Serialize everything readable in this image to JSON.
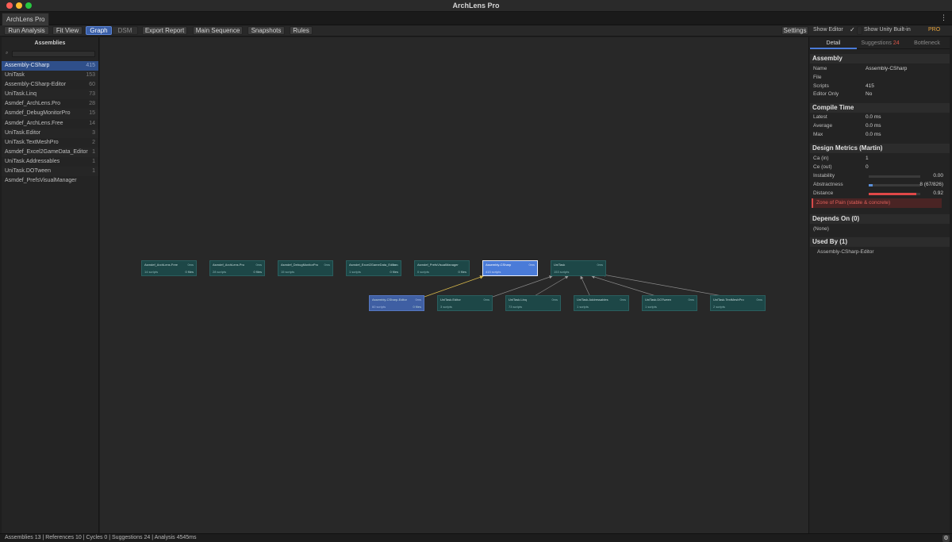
{
  "window": {
    "title": "ArchLens Pro"
  },
  "tab": {
    "label": "ArchLens Pro",
    "menu_icon": "⋮"
  },
  "toolbar": {
    "run_analysis": "Run Analysis",
    "fit_view": "Fit View",
    "graph": "Graph",
    "dsm": "DSM",
    "export_report": "Export Report",
    "main_sequence": "Main Sequence",
    "snapshots": "Snapshots",
    "rules": "Rules",
    "settings": "Settings",
    "show_editor": "Show Editor",
    "show_editor_checked": "✓",
    "show_unity_builtin": "Show Unity Built-in",
    "pro": "PRO"
  },
  "sidebar": {
    "title": "Assemblies",
    "search_icon": "⌕",
    "items": [
      {
        "name": "Assembly-CSharp",
        "count": "415"
      },
      {
        "name": "UniTask",
        "count": "153"
      },
      {
        "name": "Assembly-CSharp-Editor",
        "count": "60"
      },
      {
        "name": "UniTask.Linq",
        "count": "73"
      },
      {
        "name": "Asmdef_ArchLens.Pro",
        "count": "28"
      },
      {
        "name": "Asmdef_DebugMonitorPro",
        "count": "15"
      },
      {
        "name": "Asmdef_ArchLens.Free",
        "count": "14"
      },
      {
        "name": "UniTask.Editor",
        "count": "3"
      },
      {
        "name": "UniTask.TextMeshPro",
        "count": "2"
      },
      {
        "name": "Asmdef_Excel2GameData_Editor",
        "count": "1"
      },
      {
        "name": "UniTask.Addressables",
        "count": "1"
      },
      {
        "name": "UniTask.DOTween",
        "count": "1"
      },
      {
        "name": "Asmdef_PrefsVisualManager",
        "count": ""
      }
    ]
  },
  "graph": {
    "nodes": [
      {
        "name": "Asmdef_ArchLens.Free",
        "time": "0ms",
        "scripts": "14 scripts",
        "lines": "0 files"
      },
      {
        "name": "Asmdef_ArchLens.Pro",
        "time": "0ms",
        "scripts": "28 scripts",
        "lines": "0 files"
      },
      {
        "name": "Asmdef_DebugMonitorPro",
        "time": "0ms",
        "scripts": "15 scripts",
        "lines": ""
      },
      {
        "name": "Asmdef_Excel2GameData_Editor",
        "time": "0ms",
        "scripts": "1 scripts",
        "lines": "0 files"
      },
      {
        "name": "Asmdef_PrefsVisualManager",
        "time": "",
        "scripts": "0 scripts",
        "lines": "0 files"
      },
      {
        "name": "Assembly-CSharp",
        "time": "0ms",
        "scripts": "415 scripts",
        "lines": ""
      },
      {
        "name": "UniTask",
        "time": "0ms",
        "scripts": "153 scripts",
        "lines": ""
      },
      {
        "name": "Assembly-CSharp-Editor",
        "time": "0ms",
        "scripts": "60 scripts",
        "lines": "0 files"
      },
      {
        "name": "UniTask.Editor",
        "time": "0ms",
        "scripts": "3 scripts",
        "lines": ""
      },
      {
        "name": "UniTask.Linq",
        "time": "0ms",
        "scripts": "73 scripts",
        "lines": ""
      },
      {
        "name": "UniTask.Addressables",
        "time": "0ms",
        "scripts": "1 scripts",
        "lines": ""
      },
      {
        "name": "UniTask.DOTween",
        "time": "0ms",
        "scripts": "1 scripts",
        "lines": ""
      },
      {
        "name": "UniTask.TextMeshPro",
        "time": "0ms",
        "scripts": "2 scripts",
        "lines": ""
      }
    ]
  },
  "detail": {
    "tabs": {
      "detail": "Detail",
      "suggestions": "Suggestions",
      "suggestions_count": "24",
      "bottleneck": "Bottleneck"
    },
    "assembly": {
      "heading": "Assembly",
      "name_label": "Name",
      "name_value": "Assembly-CSharp",
      "file_label": "File",
      "file_value": "",
      "scripts_label": "Scripts",
      "scripts_value": "415",
      "editor_only_label": "Editor Only",
      "editor_only_value": "No"
    },
    "compile_time": {
      "heading": "Compile Time",
      "latest_label": "Latest",
      "latest_value": "0.0 ms",
      "average_label": "Average",
      "average_value": "0.0 ms",
      "max_label": "Max",
      "max_value": "0.0 ms"
    },
    "design_metrics": {
      "heading": "Design Metrics  (Martin)",
      "ca_label": "Ca (in)",
      "ca_value": "1",
      "ce_label": "Ce (out)",
      "ce_value": "0",
      "instability_label": "Instability",
      "instability_value": "0.00",
      "instability_fraction": 0.0,
      "abstractness_label": "Abstractness",
      "abstractness_value": "8  (67/826)",
      "abstractness_fraction": 0.08,
      "distance_label": "Distance",
      "distance_value": "0.92",
      "distance_fraction": 0.92,
      "zone": "Zone of Pain  (stable & concrete)",
      "accent_blue": "#5a8fd8",
      "accent_red": "#e04848"
    },
    "depends_on": {
      "heading": "Depends On (0)",
      "none": "(None)"
    },
    "used_by": {
      "heading": "Used By (1)",
      "items": [
        "Assembly-CSharp-Editor"
      ]
    }
  },
  "status": {
    "text": "Assemblies 13 | References 10 | Cycles 0 | Suggestions 24 | Analysis 4545ms",
    "gear_icon": "⚙"
  }
}
